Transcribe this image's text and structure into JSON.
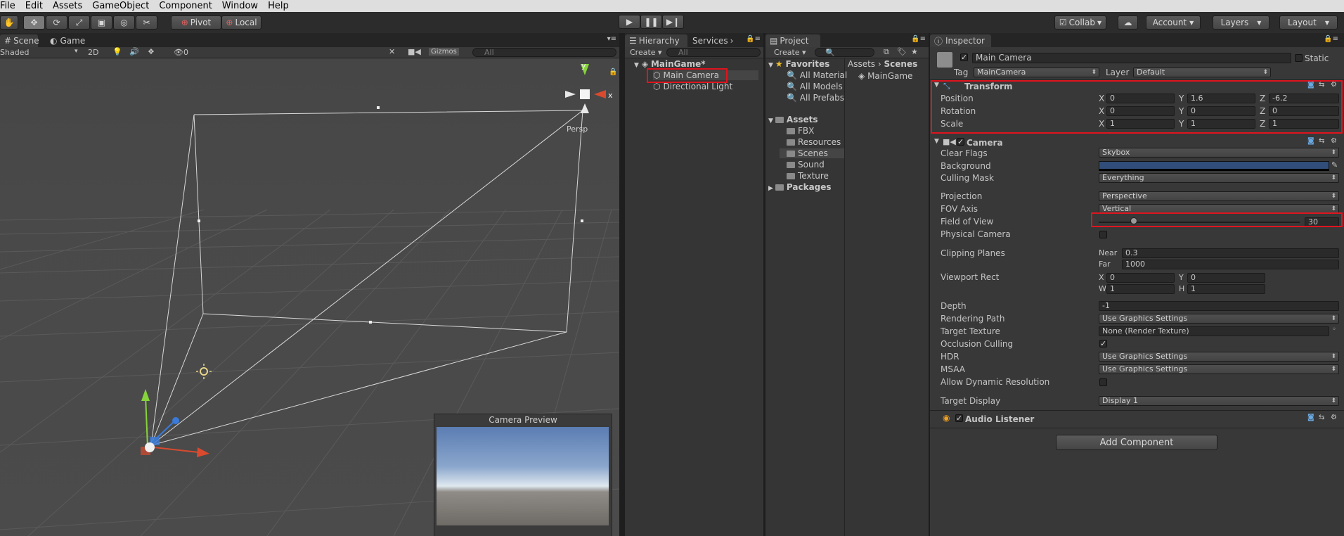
{
  "menu": [
    "File",
    "Edit",
    "Assets",
    "GameObject",
    "Component",
    "Window",
    "Help"
  ],
  "toolbar": {
    "pivot": "Pivot",
    "local": "Local",
    "collab": "Collab",
    "account": "Account",
    "layers": "Layers",
    "layout": "Layout"
  },
  "scene": {
    "tab_scene": "Scene",
    "tab_game": "Game",
    "shading": "Shaded",
    "mode2d": "2D",
    "gizmos": "Gizmos",
    "search": "All",
    "hidden_count": "0",
    "persp": "Persp",
    "axis_y": "y",
    "axis_x": "x",
    "camera_preview_title": "Camera Preview"
  },
  "hierarchy": {
    "tab": "Hierarchy",
    "tab_services": "Services",
    "create": "Create",
    "search": "All",
    "scene_name": "MainGame*",
    "items": [
      "Main Camera",
      "Directional Light"
    ]
  },
  "project": {
    "tab": "Project",
    "create": "Create",
    "favorites": "Favorites",
    "favorite_items": [
      "All Material",
      "All Models",
      "All Prefabs"
    ],
    "assets": "Assets",
    "asset_folders": [
      "FBX",
      "Resources",
      "Scenes",
      "Sound",
      "Texture"
    ],
    "packages": "Packages",
    "breadcrumb": [
      "Assets",
      "Scenes"
    ],
    "scene_file": "MainGame"
  },
  "inspector": {
    "tab": "Inspector",
    "object_name": "Main Camera",
    "static": "Static",
    "tag_label": "Tag",
    "tag": "MainCamera",
    "layer_label": "Layer",
    "layer": "Default",
    "transform": {
      "title": "Transform",
      "rows": [
        {
          "label": "Position",
          "x": "0",
          "y": "1.6",
          "z": "-6.2"
        },
        {
          "label": "Rotation",
          "x": "0",
          "y": "0",
          "z": "0"
        },
        {
          "label": "Scale",
          "x": "1",
          "y": "1",
          "z": "1"
        }
      ]
    },
    "camera": {
      "title": "Camera",
      "clear_flags_label": "Clear Flags",
      "clear_flags": "Skybox",
      "background_label": "Background",
      "background_color": "#314d79",
      "culling_mask_label": "Culling Mask",
      "culling_mask": "Everything",
      "projection_label": "Projection",
      "projection": "Perspective",
      "fov_axis_label": "FOV Axis",
      "fov_axis": "Vertical",
      "fov_label": "Field of View",
      "fov": "30",
      "physical_label": "Physical Camera",
      "clipping_label": "Clipping Planes",
      "near_label": "Near",
      "near": "0.3",
      "far_label": "Far",
      "far": "1000",
      "viewport_label": "Viewport Rect",
      "vx": "0",
      "vy": "0",
      "vw": "1",
      "vh": "1",
      "depth_label": "Depth",
      "depth": "-1",
      "rendering_path_label": "Rendering Path",
      "rendering_path": "Use Graphics Settings",
      "target_texture_label": "Target Texture",
      "target_texture": "None (Render Texture)",
      "occlusion_label": "Occlusion Culling",
      "hdr_label": "HDR",
      "hdr": "Use Graphics Settings",
      "msaa_label": "MSAA",
      "msaa": "Use Graphics Settings",
      "dyn_res_label": "Allow Dynamic Resolution",
      "target_display_label": "Target Display",
      "target_display": "Display 1"
    },
    "audio_listener": "Audio Listener",
    "add_component": "Add Component"
  },
  "colors": {
    "highlight": "#e0141e",
    "selection": "#3e5f96"
  }
}
